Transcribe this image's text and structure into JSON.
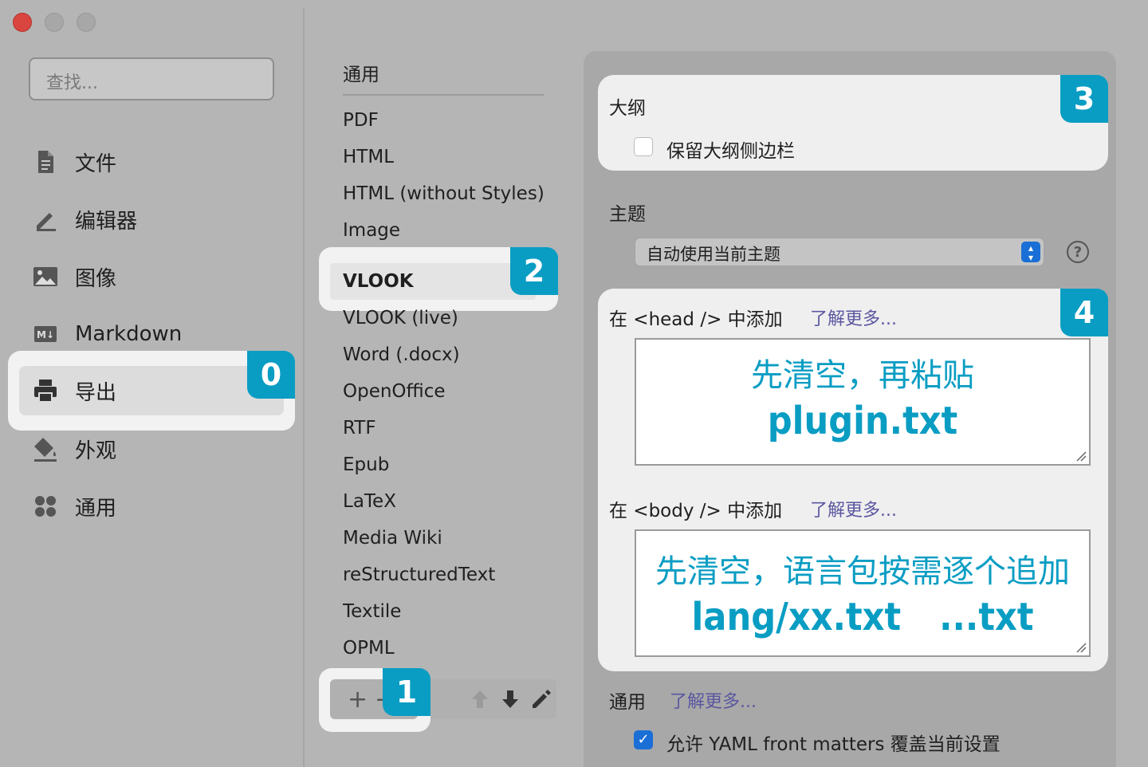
{
  "window": {
    "controls": [
      "close",
      "minimize",
      "maximize"
    ]
  },
  "sidebar": {
    "search_placeholder": "查找...",
    "items": [
      {
        "label": "文件",
        "icon": "document-icon"
      },
      {
        "label": "编辑器",
        "icon": "pencil-icon"
      },
      {
        "label": "图像",
        "icon": "image-icon"
      },
      {
        "label": "Markdown",
        "icon": "markdown-icon"
      },
      {
        "label": "导出",
        "icon": "printer-icon",
        "selected": true
      },
      {
        "label": "外观",
        "icon": "paint-bucket-icon"
      },
      {
        "label": "通用",
        "icon": "apps-grid-icon"
      }
    ]
  },
  "export_formats": {
    "general_label": "通用",
    "items": [
      "PDF",
      "HTML",
      "HTML (without Styles)",
      "Image",
      "VLOOK",
      "VLOOK (live)",
      "Word (.docx)",
      "OpenOffice",
      "RTF",
      "Epub",
      "LaTeX",
      "Media Wiki",
      "reStructuredText",
      "Textile",
      "OPML"
    ],
    "selected": "VLOOK",
    "toolbar": {
      "add": "+",
      "remove": "−"
    }
  },
  "badges": [
    "0",
    "1",
    "2",
    "3",
    "4"
  ],
  "settings": {
    "outline": {
      "title": "大纲",
      "keep_sidebar_label": "保留大纲侧边栏",
      "keep_sidebar_checked": false
    },
    "theme": {
      "title": "主题",
      "selected": "自动使用当前主题",
      "help": "?"
    },
    "head": {
      "label": "在 <head /> 中添加",
      "learn_more": "了解更多...",
      "note_line1": "先清空，再粘贴",
      "note_line2": "plugin.txt"
    },
    "body": {
      "label": "在 <body /> 中添加",
      "learn_more": "了解更多...",
      "note_line1": "先清空，语言包按需逐个追加",
      "note_line2": "lang/xx.txt　...txt"
    },
    "general": {
      "title": "通用",
      "learn_more": "了解更多...",
      "yaml_label": "允许 YAML front matters 覆盖当前设置",
      "yaml_checked": true
    }
  },
  "colors": {
    "accent": "#0a9dc3",
    "link": "#5b57a0",
    "checkbox": "#1a6fd6"
  }
}
